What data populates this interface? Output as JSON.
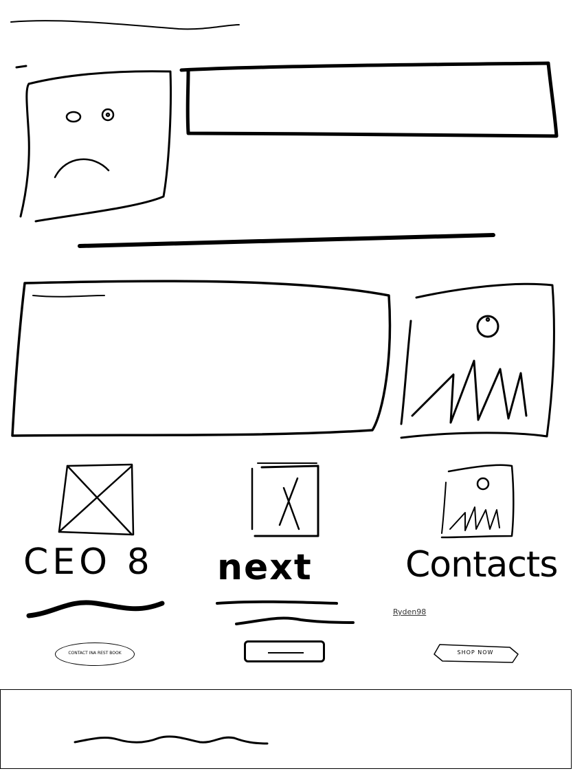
{
  "header": {
    "title_placeholder": ""
  },
  "hero": {
    "image": "sad-face-image-placeholder",
    "headline_box": "text-box-placeholder"
  },
  "intro": {
    "text_box": "text-area-placeholder",
    "image": "image-placeholder"
  },
  "columns": [
    {
      "heading": "CEO 8",
      "icon": "x-image-placeholder-icon",
      "button_label": "CONTACT INA REST BOOK"
    },
    {
      "heading": "next",
      "icon": "boxed-x-image-placeholder-icon",
      "button_label": ""
    },
    {
      "heading": "Contacts",
      "icon": "image-placeholder-icon",
      "link_text": "Ryden98",
      "button_label": "SHOP NOW"
    }
  ],
  "footer": {
    "text_placeholder": ""
  },
  "colors": {
    "ink": "#000000",
    "background": "#ffffff"
  }
}
